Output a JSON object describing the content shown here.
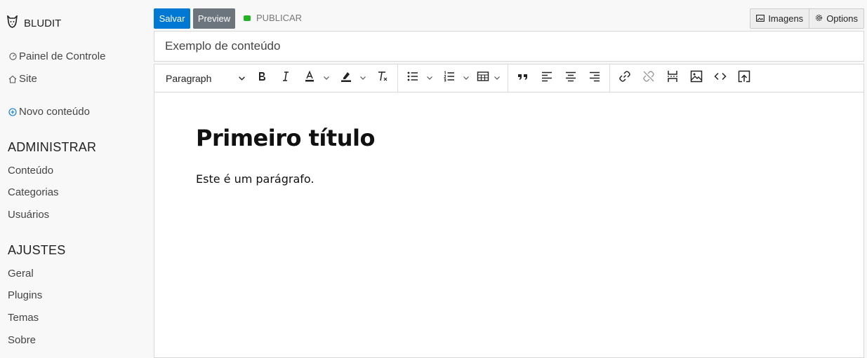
{
  "brand": {
    "name": "BLUDIT",
    "icon": "bludit-logo-icon"
  },
  "sidebar": {
    "links": [
      {
        "label": "Painel de Controle",
        "icon": "dashboard-icon"
      },
      {
        "label": "Site",
        "icon": "home-icon"
      },
      {
        "label": "Novo conteúdo",
        "icon": "plus-circle-icon"
      }
    ],
    "sections": [
      {
        "title": "ADMINISTRAR",
        "items": [
          "Conteúdo",
          "Categorias",
          "Usuários"
        ]
      },
      {
        "title": "AJUSTES",
        "items": [
          "Geral",
          "Plugins",
          "Temas",
          "Sobre"
        ]
      }
    ]
  },
  "topbar": {
    "save_label": "Salvar",
    "preview_label": "Preview",
    "status_label": "PUBLICAR",
    "images_label": "Imagens",
    "options_label": "Options"
  },
  "title_field": {
    "value": "Exemplo de conteúdo"
  },
  "toolbar": {
    "format_value": "Paragraph"
  },
  "content": {
    "heading": "Primeiro título",
    "paragraph": "Este é um parágrafo."
  },
  "colors": {
    "primary": "#0078d4",
    "secondary": "#6c757d",
    "status_green": "#22b322"
  }
}
